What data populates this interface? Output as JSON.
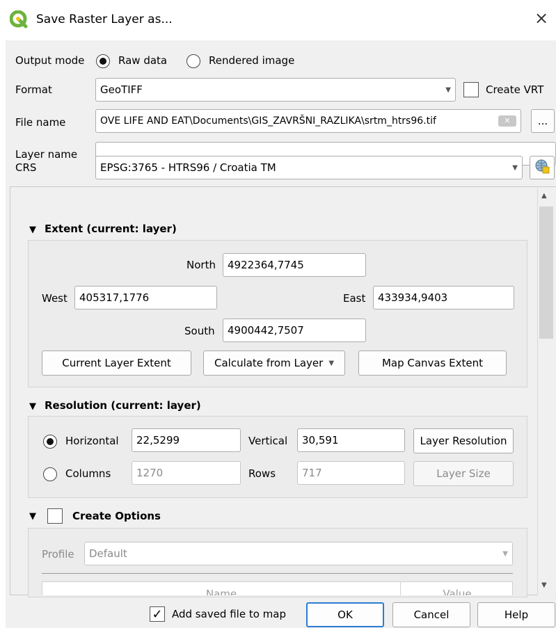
{
  "window": {
    "title": "Save Raster Layer as...",
    "close": "×"
  },
  "output_mode": {
    "label": "Output mode",
    "options": [
      "Raw data",
      "Rendered image"
    ],
    "selected": "Raw data"
  },
  "format": {
    "label": "Format",
    "value": "GeoTIFF",
    "create_vrt_label": "Create VRT",
    "create_vrt_checked": false
  },
  "file_name": {
    "label": "File name",
    "value": "OVE LIFE AND EAT\\Documents\\GIS_ZAVRŠNI_RAZLIKA\\srtm_htrs96.tif",
    "browse_label": "..."
  },
  "layer_name": {
    "label": "Layer name",
    "value": ""
  },
  "crs": {
    "label": "CRS",
    "value": "EPSG:3765 - HTRS96 / Croatia TM"
  },
  "extent": {
    "title": "Extent (current: layer)",
    "north_label": "North",
    "north": "4922364,7745",
    "west_label": "West",
    "west": "405317,1776",
    "east_label": "East",
    "east": "433934,9403",
    "south_label": "South",
    "south": "4900442,7507",
    "buttons": {
      "current_layer": "Current Layer Extent",
      "calculate": "Calculate from Layer",
      "map_canvas": "Map Canvas Extent"
    }
  },
  "resolution": {
    "title": "Resolution (current: layer)",
    "horizontal_label": "Horizontal",
    "horizontal": "22,5299",
    "vertical_label": "Vertical",
    "vertical": "30,591",
    "layer_resolution_label": "Layer Resolution",
    "columns_label": "Columns",
    "columns": "1270",
    "rows_label": "Rows",
    "rows": "717",
    "layer_size_label": "Layer Size",
    "selected": "Horizontal"
  },
  "create_options": {
    "title": "Create Options",
    "checked": false,
    "profile_label": "Profile",
    "profile": "Default",
    "table_headers": [
      "Name",
      "Value"
    ]
  },
  "footer": {
    "add_to_map_label": "Add saved file to map",
    "add_to_map_checked": true,
    "ok": "OK",
    "cancel": "Cancel",
    "help": "Help"
  },
  "colors": {
    "qgis_green": "#6cb33e",
    "qgis_yellow": "#f0c419",
    "ok_border": "#2b7cd3",
    "dialog_bg": "#f0f0f0"
  }
}
